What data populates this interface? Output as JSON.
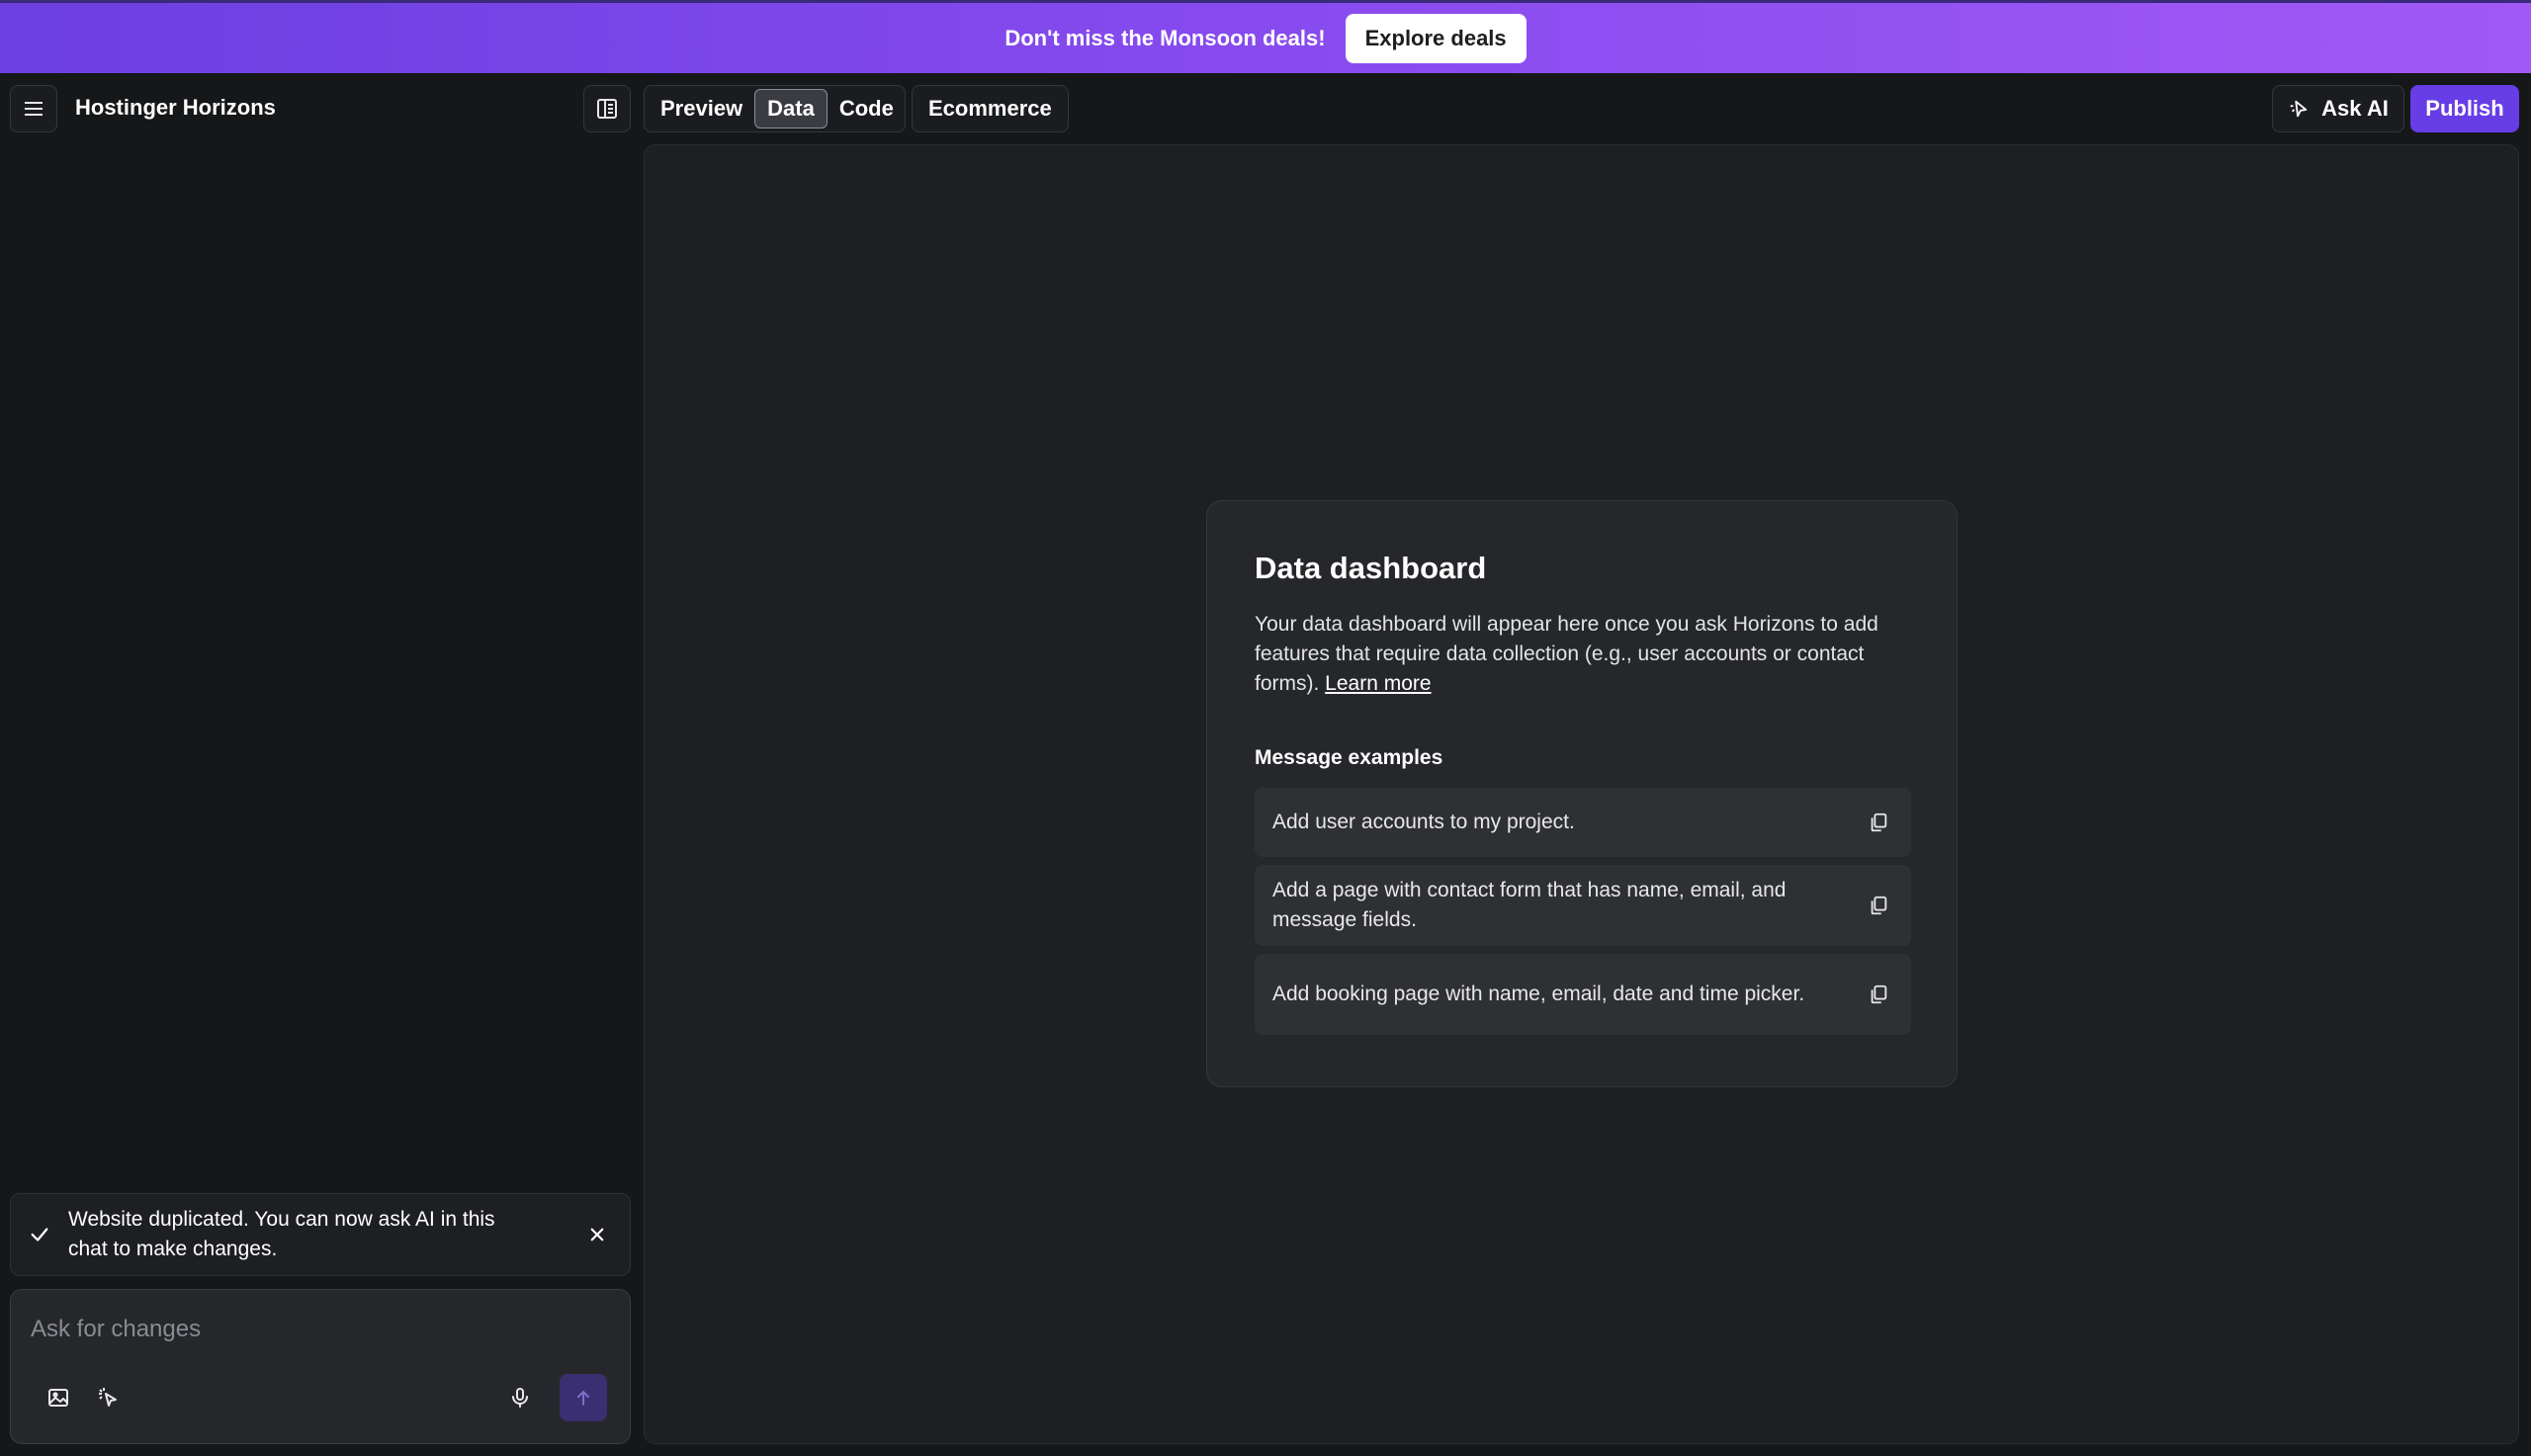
{
  "banner": {
    "text": "Don't miss the Monsoon deals!",
    "button_label": "Explore deals"
  },
  "header": {
    "app_title": "Hostinger Horizons",
    "tabs": [
      {
        "label": "Preview",
        "active": false
      },
      {
        "label": "Data",
        "active": true
      },
      {
        "label": "Code",
        "active": false
      }
    ],
    "ecommerce_label": "Ecommerce",
    "ask_ai_label": "Ask AI",
    "publish_label": "Publish"
  },
  "dashboard": {
    "title": "Data dashboard",
    "description": "Your data dashboard will appear here once you ask Horizons to add features that require data collection (e.g., user accounts or contact forms).",
    "learn_more": "Learn more",
    "examples_heading": "Message examples",
    "examples": [
      "Add user accounts to my project.",
      "Add a page with contact form that has name, email, and message fields.",
      "Add booking page with name, email, date and time picker."
    ]
  },
  "toast": {
    "message": "Website duplicated. You can now ask AI in this chat to make changes."
  },
  "composer": {
    "placeholder": "Ask for changes"
  },
  "icons": {
    "menu": "menu-icon",
    "panel": "panel-layout-icon",
    "ask_ai": "sparkle-cursor-icon",
    "copy": "copy-icon",
    "check": "check-icon",
    "close": "close-icon",
    "image": "image-icon",
    "select": "select-cursor-icon",
    "mic": "microphone-icon",
    "send": "arrow-up-icon"
  },
  "colors": {
    "accent": "#673de6",
    "banner_start": "#6c3fe0",
    "banner_end": "#a159f5",
    "background": "#161719"
  }
}
